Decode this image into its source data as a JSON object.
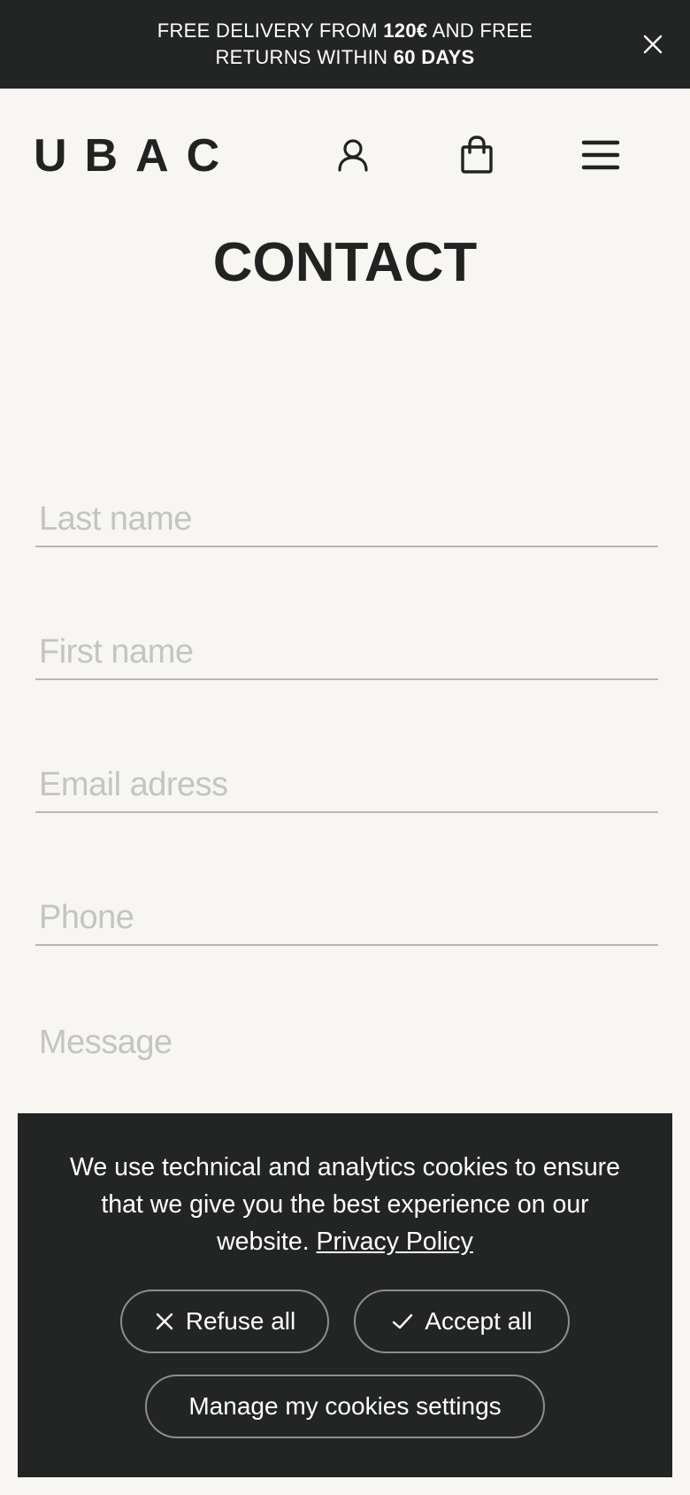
{
  "promo": {
    "line1_prefix": "FREE DELIVERY FROM ",
    "line1_bold": "120€",
    "line1_suffix": " AND FREE",
    "line2_prefix": "RETURNS WITHIN ",
    "line2_bold": "60 DAYS",
    "close_icon": "close-icon"
  },
  "header": {
    "logo": "UBAC",
    "icons": [
      "account-icon",
      "shopping-bag-icon",
      "hamburger-menu-icon"
    ]
  },
  "page": {
    "title": "CONTACT"
  },
  "form": {
    "last_name_placeholder": "Last name",
    "first_name_placeholder": "First name",
    "email_placeholder": "Email adress",
    "phone_placeholder": "Phone",
    "message_placeholder": "Message"
  },
  "cookies": {
    "text": "We use technical and analytics cookies to ensure that we give you the best experience on our website. ",
    "privacy_link": "Privacy Policy",
    "refuse_label": "Refuse all",
    "accept_label": "Accept all",
    "manage_label": "Manage my cookies settings"
  },
  "colors": {
    "dark": "#232424",
    "background": "#f7f6f3",
    "placeholder": "#c4c4c2"
  }
}
